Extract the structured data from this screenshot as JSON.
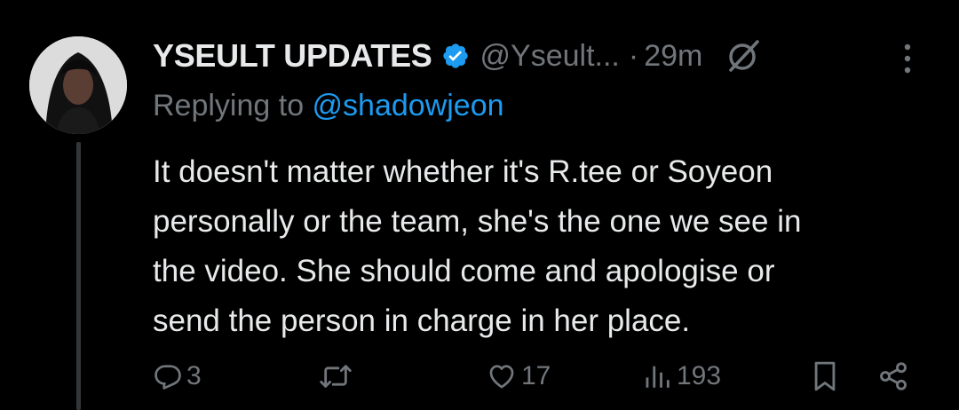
{
  "tweet": {
    "author": {
      "display_name": "YSEULT UPDATES",
      "handle": "@Yseult...",
      "verified": true
    },
    "separator": "·",
    "time": "29m",
    "reply_prefix": "Replying to ",
    "reply_mention": "@shadowjeon",
    "text_lines": [
      "It doesn't matter whether it's R.tee or Soyeon",
      "personally or the team, she's the one we see in",
      "the video. She should come and apologise or",
      "send the person in charge in her place."
    ],
    "stats": {
      "replies": "3",
      "retweets": "",
      "likes": "17",
      "views": "193"
    }
  },
  "icons": {
    "verified": "verified-badge-icon",
    "grok": "grok-icon",
    "more": "more-vertical-icon",
    "reply": "reply-icon",
    "retweet": "retweet-icon",
    "like": "heart-icon",
    "views": "views-chart-icon",
    "bookmark": "bookmark-icon",
    "share": "share-icon"
  },
  "colors": {
    "background": "#000000",
    "text": "#e7e9ea",
    "muted": "#71767b",
    "accent": "#1d9bf0",
    "thread_line": "#333639"
  }
}
